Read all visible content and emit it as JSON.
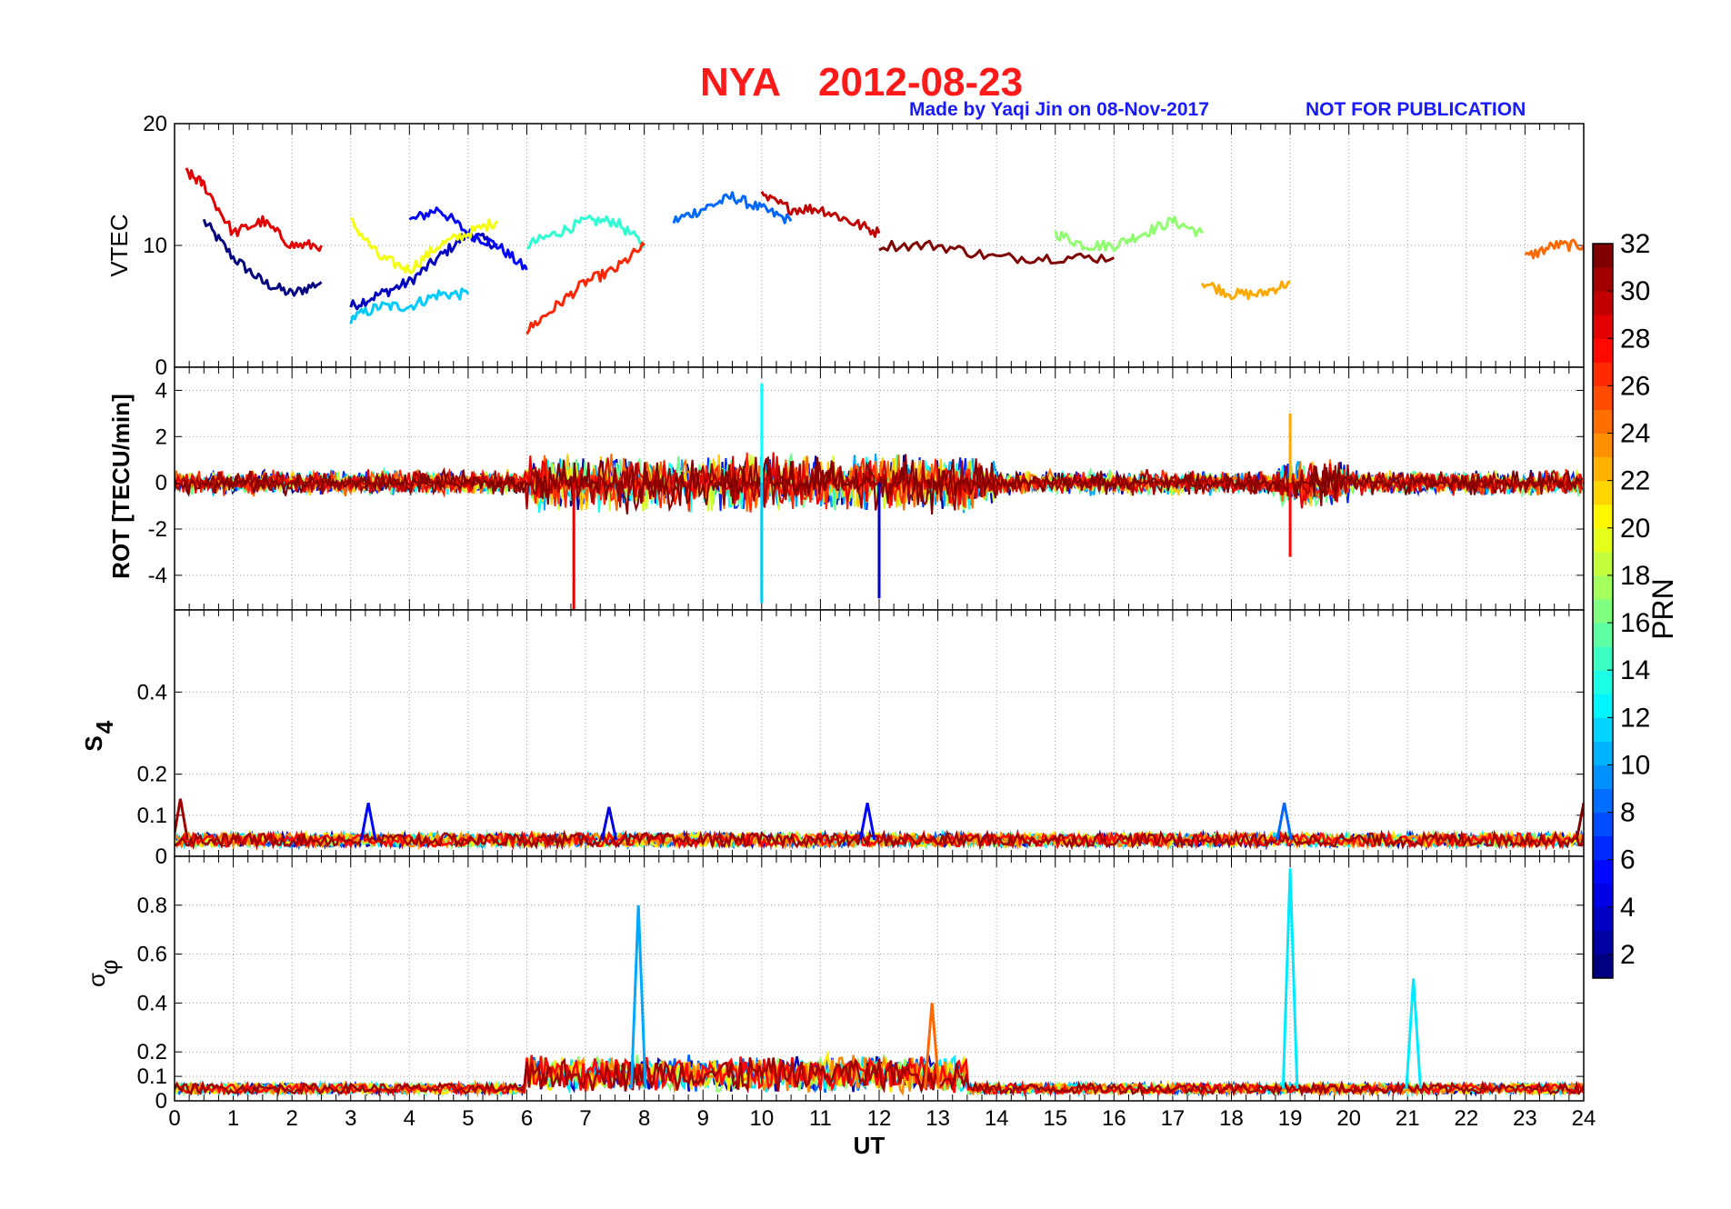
{
  "chart_data": {
    "type": "line",
    "title": "NYA",
    "date": "2012-08-23",
    "credit": "Made by Yaqi Jin on 08-Nov-2017",
    "notice": "NOT FOR PUBLICATION",
    "xlabel": "UT",
    "x_ticks": [
      "0",
      "1",
      "2",
      "3",
      "4",
      "5",
      "6",
      "7",
      "8",
      "9",
      "10",
      "11",
      "12",
      "13",
      "14",
      "15",
      "16",
      "17",
      "18",
      "19",
      "20",
      "21",
      "22",
      "23",
      "24"
    ],
    "xlim": [
      0,
      24
    ],
    "grid": true,
    "colorbar": {
      "label": "PRN",
      "colormap": "jet",
      "range": [
        1,
        32
      ],
      "ticks": [
        "2",
        "4",
        "6",
        "8",
        "10",
        "12",
        "14",
        "16",
        "18",
        "20",
        "22",
        "24",
        "26",
        "28",
        "30",
        "32"
      ]
    },
    "panels": [
      {
        "id": "vtec",
        "ylabel": "VTEC",
        "ylim": [
          0,
          20
        ],
        "y_ticks": [
          "0",
          "10",
          "20"
        ],
        "series": [
          {
            "prn": 1,
            "x": [
              0.5,
              1.0,
              1.5,
              2.0,
              2.5
            ],
            "y": [
              12,
              9,
              7,
              6,
              7
            ]
          },
          {
            "prn": 3,
            "x": [
              3.0,
              3.5,
              4.0,
              4.5,
              5.0,
              5.5
            ],
            "y": [
              5,
              6,
              7,
              9,
              11,
              10
            ]
          },
          {
            "prn": 5,
            "x": [
              4.0,
              4.5,
              5.0,
              5.5,
              6.0
            ],
            "y": [
              12,
              13,
              11,
              10,
              8
            ]
          },
          {
            "prn": 8,
            "x": [
              8.5,
              9.0,
              9.5,
              10.0,
              10.5
            ],
            "y": [
              12,
              13,
              14,
              13,
              12
            ]
          },
          {
            "prn": 11,
            "x": [
              3.0,
              3.5,
              4.0,
              4.5,
              5.0
            ],
            "y": [
              4,
              5,
              5,
              6,
              6
            ]
          },
          {
            "prn": 14,
            "x": [
              6.0,
              6.5,
              7.0,
              7.5,
              8.0
            ],
            "y": [
              10,
              11,
              12,
              12,
              10
            ]
          },
          {
            "prn": 17,
            "x": [
              15.0,
              15.5,
              16.0,
              16.5,
              17.0,
              17.5
            ],
            "y": [
              11,
              10,
              10,
              11,
              12,
              11
            ]
          },
          {
            "prn": 20,
            "x": [
              3.0,
              3.5,
              4.0,
              4.5,
              5.0,
              5.5
            ],
            "y": [
              12,
              9,
              8,
              10,
              11,
              12
            ]
          },
          {
            "prn": 23,
            "x": [
              17.5,
              18.0,
              18.5,
              19.0
            ],
            "y": [
              7,
              6,
              6,
              7
            ]
          },
          {
            "prn": 25,
            "x": [
              23.0,
              23.5,
              24.0
            ],
            "y": [
              9,
              10,
              10
            ]
          },
          {
            "prn": 27,
            "x": [
              6.0,
              6.5,
              7.0,
              7.5,
              8.0
            ],
            "y": [
              3,
              5,
              7,
              8,
              10
            ]
          },
          {
            "prn": 29,
            "x": [
              0.2,
              0.5,
              1.0,
              1.5,
              2.0,
              2.5
            ],
            "y": [
              16,
              15,
              11,
              12,
              10,
              10
            ]
          },
          {
            "prn": 30,
            "x": [
              10.0,
              10.5,
              11.0,
              11.5,
              12.0
            ],
            "y": [
              14,
              13,
              13,
              12,
              11
            ]
          },
          {
            "prn": 32,
            "x": [
              12.0,
              13.0,
              14.0,
              15.0,
              16.0
            ],
            "y": [
              10,
              10,
              9,
              9,
              9
            ]
          }
        ]
      },
      {
        "id": "rot",
        "ylabel": "ROT [TECU/min]",
        "ylim": [
          -5.5,
          5
        ],
        "y_ticks": [
          "-4",
          "-2",
          "0",
          "2",
          "4"
        ],
        "notable_spikes": [
          {
            "x": 6.8,
            "y": -5.5
          },
          {
            "x": 10.0,
            "y": 4.3
          },
          {
            "x": 10.0,
            "y": -5.2
          },
          {
            "x": 12.0,
            "y": -5.0
          },
          {
            "x": 19.0,
            "y": 3.0
          },
          {
            "x": 19.0,
            "y": -3.2
          }
        ]
      },
      {
        "id": "s4",
        "ylabel": "S4",
        "ylim": [
          0,
          0.6
        ],
        "y_ticks": [
          "0",
          "0.1",
          "0.2",
          "0.4"
        ],
        "typical_level": 0.04,
        "notable_peaks": [
          {
            "x": 0.1,
            "y": 0.14
          },
          {
            "x": 3.3,
            "y": 0.13
          },
          {
            "x": 7.4,
            "y": 0.12
          },
          {
            "x": 11.8,
            "y": 0.13
          },
          {
            "x": 18.9,
            "y": 0.13
          },
          {
            "x": 24.0,
            "y": 0.13
          }
        ]
      },
      {
        "id": "sigma_phi",
        "ylabel": "σφ",
        "ylim": [
          0,
          1
        ],
        "y_ticks": [
          "0",
          "0.1",
          "0.2",
          "0.4",
          "0.6",
          "0.8"
        ],
        "typical_level": 0.05,
        "notable_peaks": [
          {
            "x": 7.9,
            "y": 0.8
          },
          {
            "x": 12.9,
            "y": 0.4
          },
          {
            "x": 19.0,
            "y": 0.95
          },
          {
            "x": 21.1,
            "y": 0.5
          }
        ]
      }
    ]
  }
}
